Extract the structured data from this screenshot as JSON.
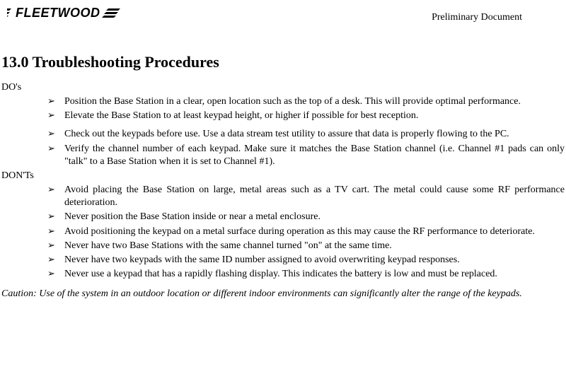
{
  "header": {
    "logo_text": "FLEETWOOD",
    "doc_label": "Preliminary Document"
  },
  "title": "13.0 Troubleshooting Procedures",
  "dos": {
    "label": "DO's",
    "group1": [
      "Position the Base Station in a clear, open location such as the top of a desk.  This will provide optimal performance.",
      "Elevate the Base Station to at least keypad height, or higher if possible for best reception."
    ],
    "group2": [
      "Check out the keypads before use.  Use a data stream test utility to assure that data is properly flowing to the PC.",
      "Verify the channel number of each keypad.  Make sure it matches the Base Station channel (i.e. Channel #1 pads can only \"talk\" to a Base Station when it is set to Channel #1)."
    ]
  },
  "donts": {
    "label": "DON'Ts",
    "items": [
      "Avoid placing the Base Station on large, metal areas such as a TV cart.  The metal could cause some RF performance deterioration.",
      "Never position the Base Station inside or near a metal enclosure.",
      "Avoid positioning the keypad on a metal surface during operation as this may cause the RF performance to deteriorate.",
      "Never have two Base Stations with the same channel turned \"on\" at the same time.",
      "Never have two keypads with the same ID number assigned to avoid overwriting keypad responses.",
      "Never use a keypad that has a rapidly flashing display.  This indicates the battery is low and must be replaced."
    ]
  },
  "caution": "Caution:  Use of the system in an outdoor location or different indoor environments can significantly alter the range of the keypads."
}
